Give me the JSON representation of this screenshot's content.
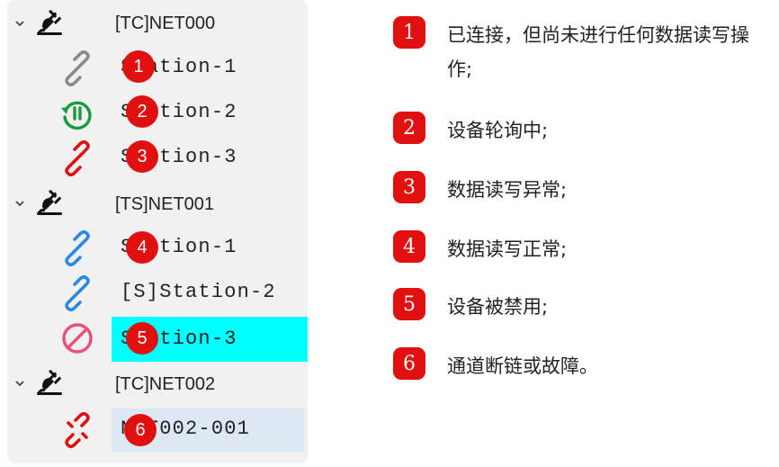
{
  "tree": {
    "groups": [
      {
        "label": "[TC]NET000",
        "icon": "plug-icon",
        "stations": [
          {
            "prefix": "",
            "name": "Station-1",
            "marker": "1",
            "icon": "link-icon",
            "icon_color": "#8a8a8a",
            "state": "connected-idle"
          },
          {
            "prefix": "",
            "name": "Station-2",
            "marker": "2",
            "icon": "polling-icon",
            "icon_color": "#1a9a3a",
            "state": "polling"
          },
          {
            "prefix": "",
            "name": "Station-3",
            "marker": "3",
            "icon": "link-icon",
            "icon_color": "#e01010",
            "state": "error"
          }
        ]
      },
      {
        "label": "[TS]NET001",
        "icon": "plug-icon",
        "stations": [
          {
            "prefix": "",
            "name": "Station-1",
            "marker": "4",
            "icon": "link-icon",
            "icon_color": "#2a8ae0",
            "state": "normal"
          },
          {
            "prefix": "[S]",
            "name": "Station-2",
            "marker": "",
            "icon": "link-icon",
            "icon_color": "#2a8ae0",
            "state": "normal"
          },
          {
            "prefix": "",
            "name": "Station-3",
            "marker": "5",
            "icon": "disabled-icon",
            "icon_color": "#e8507a",
            "state": "disabled",
            "selected": true
          }
        ]
      },
      {
        "label": "[TC]NET002",
        "icon": "plug-icon",
        "stations": [
          {
            "prefix": "",
            "name": "NET002-001",
            "marker": "6",
            "icon": "broken-link-icon",
            "icon_color": "#e01010",
            "state": "broken"
          }
        ]
      }
    ]
  },
  "legend": [
    {
      "num": "1",
      "text": "已连接，但尚未进行任何数据读写操作;"
    },
    {
      "num": "2",
      "text": "设备轮询中;"
    },
    {
      "num": "3",
      "text": "数据读写异常;"
    },
    {
      "num": "4",
      "text": "数据读写正常;"
    },
    {
      "num": "5",
      "text": "设备被禁用;"
    },
    {
      "num": "6",
      "text": "通道断链或故障。"
    }
  ],
  "colors": {
    "marker": "#e01010",
    "selected_bg": "#00ffff",
    "hover_bg": "#dde8f4",
    "tree_bg": "#f1f1f1"
  }
}
